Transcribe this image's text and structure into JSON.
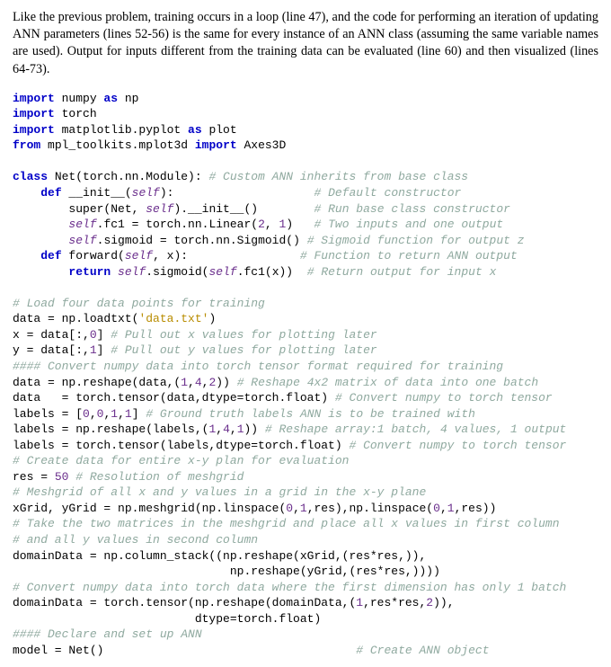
{
  "intro": "Like the previous problem, training occurs in a loop (line 47), and the code for performing an iteration of updating ANN parameters (lines 52-56) is the same for every instance of an ANN class (assuming the same variable names are used). Output for inputs different from the training data can be evaluated (line 60) and then visualized (lines 64-73).",
  "code": {
    "l01a": "import",
    "l01b": " numpy ",
    "l01c": "as",
    "l01d": " np",
    "l02a": "import",
    "l02b": " torch",
    "l03a": "import",
    "l03b": " matplotlib.pyplot ",
    "l03c": "as",
    "l03d": " plot",
    "l04a": "from",
    "l04b": " mpl_toolkits.mplot3d ",
    "l04c": "import",
    "l04d": " Axes3D",
    "l06a": "class",
    "l06b": " Net(torch.nn.Module): ",
    "l06c": "# Custom ANN inherits from base class",
    "l07a": "    ",
    "l07b": "def",
    "l07c": " __init__(",
    "l07d": "self",
    "l07e": "):",
    "l07pad": "                    ",
    "l07f": "# Default constructor",
    "l08a": "        super(Net, ",
    "l08b": "self",
    "l08c": ").__init__()",
    "l08pad": "        ",
    "l08d": "# Run base class constructor",
    "l09a": "        ",
    "l09b": "self",
    "l09c": ".fc1 = torch.nn.Linear(",
    "l09n1": "2",
    "l09s": ", ",
    "l09n2": "1",
    "l09d": ")",
    "l09pad": "   ",
    "l09e": "# Two inputs and one output",
    "l10a": "        ",
    "l10b": "self",
    "l10c": ".sigmoid = torch.nn.Sigmoid() ",
    "l10d": "# Sigmoid function for output z",
    "l11a": "    ",
    "l11b": "def",
    "l11c": " forward(",
    "l11d": "self",
    "l11e": ", x):",
    "l11pad": "                ",
    "l11f": "# Function to return ANN output",
    "l12a": "        ",
    "l12b": "return",
    "l12c": " ",
    "l12d": "self",
    "l12e": ".sigmoid(",
    "l12f": "self",
    "l12g": ".fc1(x))",
    "l12pad": "  ",
    "l12h": "# Return output for input x",
    "l14a": "# Load four data points for training",
    "l15a": "data = np.loadtxt(",
    "l15b": "'data.txt'",
    "l15c": ")",
    "l16a": "x = data[:,",
    "l16n": "0",
    "l16b": "] ",
    "l16c": "# Pull out x values for plotting later",
    "l17a": "y = data[:,",
    "l17n": "1",
    "l17b": "] ",
    "l17c": "# Pull out y values for plotting later",
    "l18a": "#### Convert numpy data into torch tensor format required for training",
    "l19a": "data = np.reshape(data,(",
    "l19n1": "1",
    "l19s1": ",",
    "l19n2": "4",
    "l19s2": ",",
    "l19n3": "2",
    "l19b": ")) ",
    "l19c": "# Reshape 4x2 matrix of data into one batch",
    "l20a": "data   = torch.tensor(data,dtype=torch.float) ",
    "l20b": "# Convert numpy to torch tensor",
    "l21a": "labels = [",
    "l21n1": "0",
    "l21s1": ",",
    "l21n2": "0",
    "l21s2": ",",
    "l21n3": "1",
    "l21s3": ",",
    "l21n4": "1",
    "l21b": "] ",
    "l21c": "# Ground truth labels ANN is to be trained with",
    "l22a": "labels = np.reshape(labels,(",
    "l22n1": "1",
    "l22s1": ",",
    "l22n2": "4",
    "l22s2": ",",
    "l22n3": "1",
    "l22b": ")) ",
    "l22c": "# Reshape array:1 batch, 4 values, 1 output",
    "l23a": "labels = torch.tensor(labels,dtype=torch.float) ",
    "l23b": "# Convert numpy to torch tensor",
    "l24a": "# Create data for entire x-y plan for evaluation",
    "l25a": "res = ",
    "l25n": "50",
    "l25b": " ",
    "l25c": "# Resolution of meshgrid",
    "l26a": "# Meshgrid of all x and y values in a grid in the x-y plane",
    "l27a": "xGrid, yGrid = np.meshgrid(np.linspace(",
    "l27n1": "0",
    "l27s1": ",",
    "l27n2": "1",
    "l27b": ",res),np.linspace(",
    "l27n3": "0",
    "l27s2": ",",
    "l27n4": "1",
    "l27c": ",res))",
    "l28a": "# Take the two matrices in the meshgrid and place all x values in first column",
    "l29a": "# and all y values in second column",
    "l30a": "domainData = np.column_stack((np.reshape(xGrid,(res*res,)),",
    "l31a": "                               np.reshape(yGrid,(res*res,))))",
    "l32a": "# Convert numpy data into torch data where the first dimension has only 1 batch",
    "l33a": "domainData = torch.tensor(np.reshape(domainData,(",
    "l33n1": "1",
    "l33b": ",res*res,",
    "l33n2": "2",
    "l33c": ")),",
    "l34a": "                          dtype=torch.float)",
    "l35a": "#### Declare and set up ANN",
    "l36a": "model = Net()",
    "l36pad": "                                    ",
    "l36b": "# Create ANN object"
  }
}
